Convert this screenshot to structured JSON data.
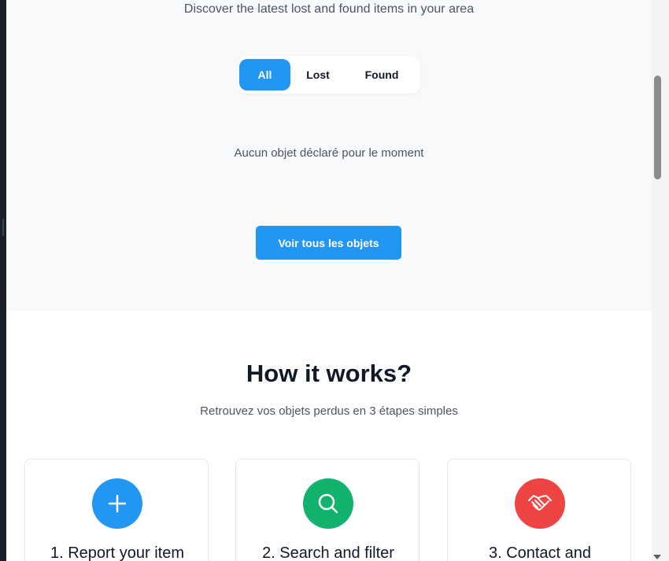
{
  "recent": {
    "subtitle": "Discover the latest lost and found items in your area",
    "filters": [
      {
        "label": "All",
        "active": true
      },
      {
        "label": "Lost",
        "active": false
      },
      {
        "label": "Found",
        "active": false
      }
    ],
    "empty_message": "Aucun objet déclaré pour le moment",
    "see_all_label": "Voir tous les objets"
  },
  "how": {
    "title": "How it works?",
    "subtitle": "Retrouvez vos objets perdus en 3 étapes simples",
    "steps": [
      {
        "title": "1. Report your item",
        "icon": "plus-icon",
        "color": "#2196f3"
      },
      {
        "title": "2. Search and filter",
        "icon": "search-icon",
        "color": "#10b26c"
      },
      {
        "title": "3. Contact and",
        "icon": "handshake-icon",
        "color": "#ef4444"
      }
    ]
  },
  "colors": {
    "accent": "#2196f3",
    "green": "#10b26c",
    "red": "#ef4444"
  }
}
